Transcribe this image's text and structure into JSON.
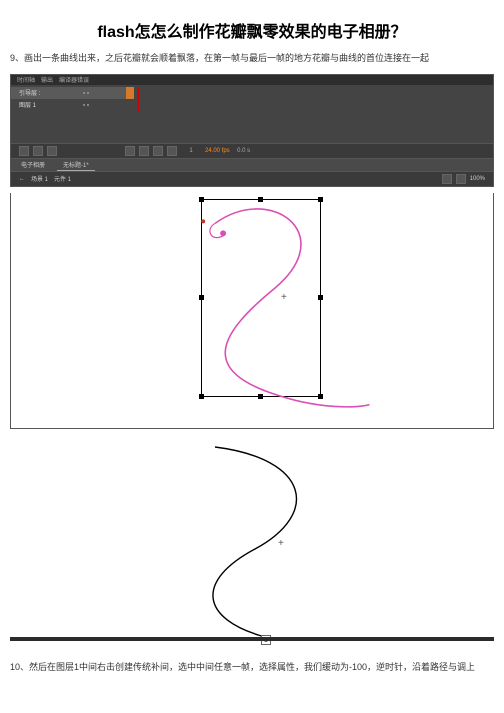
{
  "title": "flash怎怎么制作花瓣飘零效果的电子相册？",
  "step9": "9、画出一条曲线出来，之后花瓣就会顺着飘落，在第一帧与最后一帧的地方花瓣与曲线的首位连接在一起",
  "step10": "10、然后在图层1中间右击创建传统补间，选中中间任意一帧，选择属性，我们缓动为-100，逆时针，沿着路径与调上",
  "flash_ui": {
    "top_tabs": {
      "tab1": "时间轴",
      "tab2": "输出",
      "tab3": "编译器错误"
    },
    "layers": {
      "layer2": "引导层 :",
      "layer1": "图层 1"
    },
    "footer": {
      "frame": "1",
      "fps": "24.00 fps",
      "time": "0.0 s"
    },
    "doc_tabs": {
      "tab1": "电子相册",
      "tab2": "无标题-1*"
    },
    "scene": {
      "back": "←",
      "scene_label": "场景 1",
      "symbol_label": "元件 1",
      "zoom": "100%"
    }
  }
}
